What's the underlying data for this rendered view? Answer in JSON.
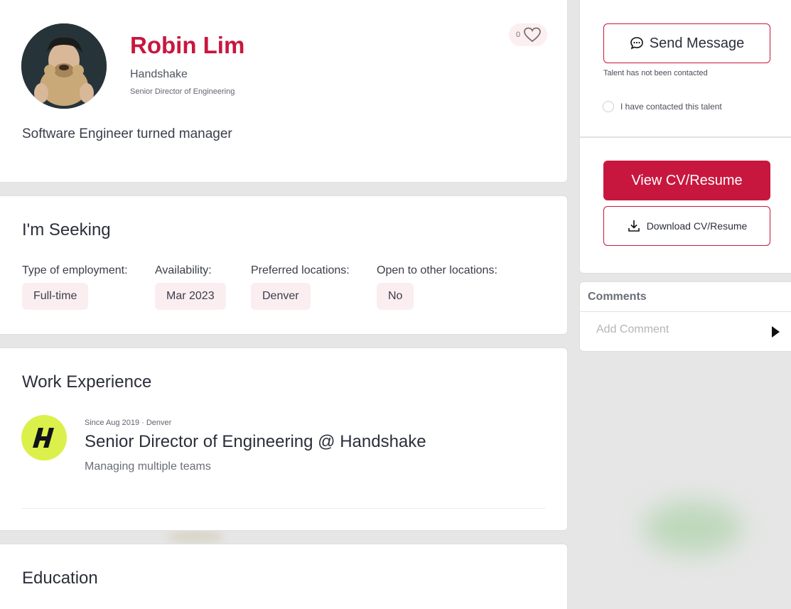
{
  "profile": {
    "name": "Robin Lim",
    "company": "Handshake",
    "title": "Senior Director of Engineering",
    "bio": "Software Engineer turned manager",
    "likes": "0"
  },
  "seeking": {
    "heading": "I'm Seeking",
    "fields": [
      {
        "label": "Type of employment:",
        "value": "Full-time"
      },
      {
        "label": "Availability:",
        "value": "Mar 2023"
      },
      {
        "label": "Preferred locations:",
        "value": "Denver"
      },
      {
        "label": "Open to other locations:",
        "value": "No"
      }
    ]
  },
  "work": {
    "heading": "Work Experience",
    "items": [
      {
        "logo_letter": "H",
        "meta": "Since Aug 2019 · Denver",
        "role": "Senior Director of Engineering @ Handshake",
        "description": "Managing multiple teams"
      }
    ]
  },
  "education": {
    "heading": "Education"
  },
  "actions": {
    "send_message": "Send Message",
    "contact_status": "Talent has not been contacted",
    "contacted_checkbox": "I have contacted this talent",
    "view_cv": "View CV/Resume",
    "download_cv": "Download CV/Resume"
  },
  "comments": {
    "heading": "Comments",
    "placeholder": "Add Comment"
  },
  "colors": {
    "accent": "#c8173f",
    "pill_bg": "#fbeef0",
    "logo_bg": "#dbf04a"
  }
}
